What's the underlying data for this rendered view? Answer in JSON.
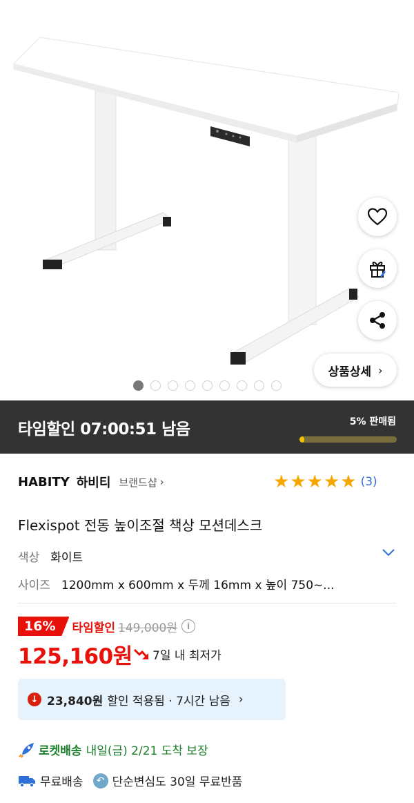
{
  "gallery": {
    "dot_count": 9,
    "active_index": 0,
    "detail_button": "상품상세"
  },
  "timesale": {
    "label": "타임할인 07:00:51 남음",
    "sold": "5% 판매됨",
    "sold_fraction": 0.05
  },
  "brand": {
    "name_en": "HABITY",
    "name_ko": "하비티",
    "shop_link": "브랜드샵"
  },
  "rating": {
    "stars": 5,
    "count": "(3)"
  },
  "product": {
    "title": "Flexispot 전동 높이조절 책상 모션데스크",
    "color_key": "색상",
    "color_value": "화이트",
    "size_key": "사이즈",
    "size_value": "1200mm x 600mm x 두께 16mm x 높이 750~..."
  },
  "price": {
    "discount_pct": "16%",
    "discount_label": "타임할인",
    "original": "149,000원",
    "info_icon": "i",
    "sale": "125,160원",
    "lowest_label": "7일 내 최저가"
  },
  "coupon": {
    "amount": "23,840원",
    "text": "할인 적용됨 · 7시간 남음"
  },
  "delivery": {
    "rocket_label": "로켓배송",
    "rocket_date": "내일(금) 2/21 도착 보장",
    "free_shipping": "무료배송",
    "free_return": "단순변심도 30일 무료반품"
  },
  "colors": {
    "accent_red": "#e8110a",
    "rocket_green": "#1b7f2a",
    "star": "#f5a700",
    "link_blue": "#2f6fd8"
  }
}
